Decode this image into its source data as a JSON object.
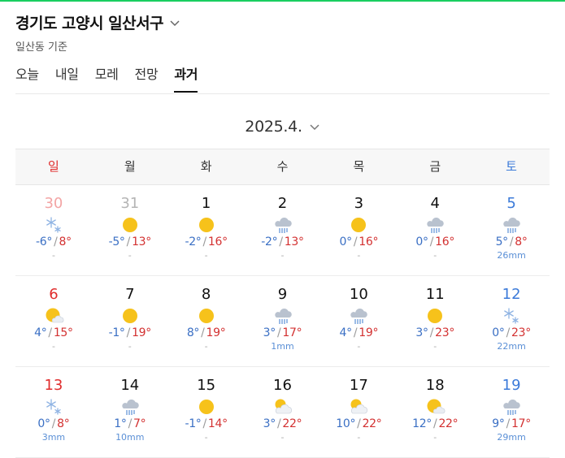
{
  "location": {
    "title": "경기도 고양시 일산서구",
    "basis": "일산동 기준"
  },
  "tabs": [
    {
      "label": "오늘",
      "active": false
    },
    {
      "label": "내일",
      "active": false
    },
    {
      "label": "모레",
      "active": false
    },
    {
      "label": "전망",
      "active": false
    },
    {
      "label": "과거",
      "active": true
    }
  ],
  "month": "2025.4.",
  "weekdays": [
    "일",
    "월",
    "화",
    "수",
    "목",
    "금",
    "토"
  ],
  "colors": {
    "sunday": "#e02d2d",
    "saturday": "#3b7ad9",
    "low": "#3a6fc4",
    "high": "#d33131",
    "sun": "#f6c21b"
  },
  "weeks": [
    [
      {
        "day": "30",
        "prev": true,
        "icon": "snow-icon",
        "low": "-6°",
        "high": "8°",
        "rain": "-"
      },
      {
        "day": "31",
        "prev": true,
        "icon": "sun-icon",
        "low": "-5°",
        "high": "13°",
        "rain": "-"
      },
      {
        "day": "1",
        "icon": "sun-icon",
        "low": "-2°",
        "high": "16°",
        "rain": "-"
      },
      {
        "day": "2",
        "icon": "rain-cloud-icon",
        "low": "-2°",
        "high": "13°",
        "rain": "-"
      },
      {
        "day": "3",
        "icon": "sun-icon",
        "low": "0°",
        "high": "16°",
        "rain": "-"
      },
      {
        "day": "4",
        "icon": "rain-cloud-icon",
        "low": "0°",
        "high": "16°",
        "rain": "-"
      },
      {
        "day": "5",
        "icon": "rain-cloud-icon",
        "low": "5°",
        "high": "8°",
        "rain": "26mm"
      }
    ],
    [
      {
        "day": "6",
        "icon": "sun-cloud-icon",
        "low": "4°",
        "high": "15°",
        "rain": "-"
      },
      {
        "day": "7",
        "icon": "sun-icon",
        "low": "-1°",
        "high": "19°",
        "rain": "-"
      },
      {
        "day": "8",
        "icon": "sun-icon",
        "low": "8°",
        "high": "19°",
        "rain": "-"
      },
      {
        "day": "9",
        "icon": "rain-cloud-icon",
        "low": "3°",
        "high": "17°",
        "rain": "1mm"
      },
      {
        "day": "10",
        "icon": "rain-cloud-icon",
        "low": "4°",
        "high": "19°",
        "rain": "-"
      },
      {
        "day": "11",
        "icon": "sun-icon",
        "low": "3°",
        "high": "23°",
        "rain": "-"
      },
      {
        "day": "12",
        "icon": "snow-icon",
        "low": "0°",
        "high": "23°",
        "rain": "22mm"
      }
    ],
    [
      {
        "day": "13",
        "icon": "snow-icon",
        "low": "0°",
        "high": "8°",
        "rain": "3mm"
      },
      {
        "day": "14",
        "icon": "rain-cloud-icon",
        "low": "1°",
        "high": "7°",
        "rain": "10mm"
      },
      {
        "day": "15",
        "icon": "sun-icon",
        "low": "-1°",
        "high": "14°",
        "rain": "-"
      },
      {
        "day": "16",
        "icon": "partly-cloudy-icon",
        "low": "3°",
        "high": "22°",
        "rain": "-"
      },
      {
        "day": "17",
        "icon": "partly-cloudy-icon",
        "low": "10°",
        "high": "22°",
        "rain": "-"
      },
      {
        "day": "18",
        "icon": "sun-cloud-icon",
        "low": "12°",
        "high": "22°",
        "rain": "-"
      },
      {
        "day": "19",
        "icon": "rain-cloud-icon",
        "low": "9°",
        "high": "17°",
        "rain": "29mm"
      }
    ]
  ]
}
